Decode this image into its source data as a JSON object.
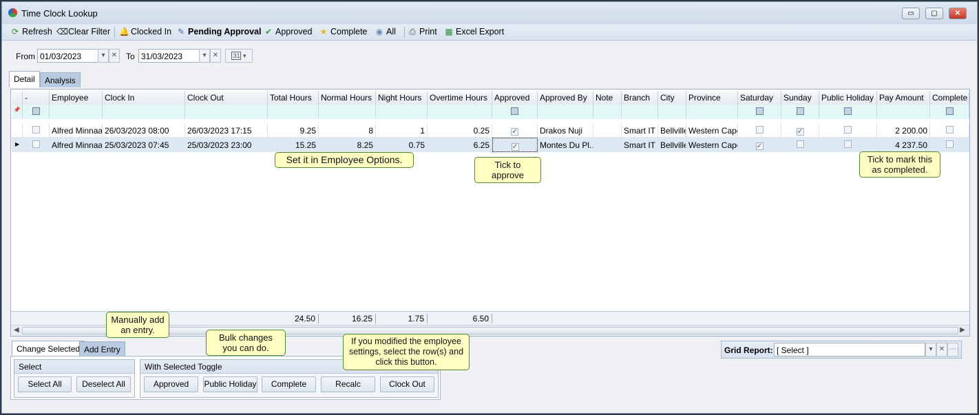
{
  "window": {
    "title": "Time Clock Lookup",
    "minimize": "▭",
    "maximize": "▢",
    "close": "✕"
  },
  "toolbar": [
    {
      "label": "Refresh",
      "icon": "refresh-icon",
      "glyph": "⟳",
      "color": "#3a8a3a"
    },
    {
      "label": "Clear Filter",
      "icon": "clear-filter-icon",
      "glyph": "⌫",
      "color": "#222"
    },
    {
      "label": "Clocked In",
      "icon": "bell-icon",
      "glyph": "🔔",
      "color": "#c9a227"
    },
    {
      "label": "Pending Approval",
      "icon": "pending-document-icon",
      "glyph": "✎",
      "color": "#3d6fb0",
      "bold": true
    },
    {
      "label": "Approved",
      "icon": "checkmark-icon",
      "glyph": "✔",
      "color": "#3a9a3a"
    },
    {
      "label": "Complete",
      "icon": "star-icon",
      "glyph": "★",
      "color": "#e9b520"
    },
    {
      "label": "All",
      "icon": "globe-icon",
      "glyph": "◉",
      "color": "#6f8eb0"
    },
    {
      "label": "Print",
      "icon": "print-preview-icon",
      "glyph": "⎙",
      "color": "#555"
    },
    {
      "label": "Excel Export",
      "icon": "excel-icon",
      "glyph": "▦",
      "color": "#2e8b3e"
    }
  ],
  "filter": {
    "from_label": "From",
    "from_value": "01/03/2023",
    "to_label": "To",
    "to_value": "31/03/2023",
    "calendar": "31"
  },
  "tabs": [
    "Detail",
    "Analysis"
  ],
  "grid": {
    "columns": [
      "-",
      "Employee",
      "Clock In",
      "Clock Out",
      "Total Hours",
      "Normal Hours",
      "Night Hours",
      "Overtime Hours",
      "Approved",
      "Approved By",
      "Note",
      "Branch",
      "City",
      "Province",
      "Saturday",
      "Sunday",
      "Public Holiday",
      "Pay Amount",
      "Complete"
    ],
    "rows": [
      {
        "selected": false,
        "employee": "Alfred Minnaar",
        "clock_in": "26/03/2023 08:00",
        "clock_out": "26/03/2023 17:15",
        "total": "9.25",
        "normal": "8",
        "night": "1",
        "overtime": "0.25",
        "approved": true,
        "approved_by": "Drakos Nuji",
        "note": "",
        "branch": "Smart IT",
        "city": "Bellville",
        "province": "Western Cape",
        "saturday": false,
        "sunday": true,
        "public_holiday": false,
        "pay": "2 200.00",
        "complete": false
      },
      {
        "selected": false,
        "employee": "Alfred Minnaar",
        "clock_in": "25/03/2023 07:45",
        "clock_out": "25/03/2023 23:00",
        "total": "15.25",
        "normal": "8.25",
        "night": "0.75",
        "overtime": "6.25",
        "approved": true,
        "approved_by": "Montes Du Pl...",
        "note": "",
        "branch": "Smart IT",
        "city": "Bellville",
        "province": "Western Cape",
        "saturday": true,
        "sunday": false,
        "public_holiday": false,
        "pay": "4 237.50",
        "complete": false,
        "current": true
      }
    ],
    "totals": {
      "total": "24.50",
      "normal": "16.25",
      "night": "1.75",
      "overtime": "6.50"
    }
  },
  "tips": {
    "employee_options": "Set it in Employee Options.",
    "approve": "Tick to approve",
    "complete": "Tick to mark this as completed.",
    "add_entry": "Manually add an entry.",
    "bulk": "Bulk changes you can do.",
    "recalc": "If you modified the employee settings, select the row(s) and click this button."
  },
  "bottom": {
    "tabs": [
      "Change Selected",
      "Add Entry"
    ],
    "select_group": "Select",
    "select_all": "Select All",
    "deselect_all": "Deselect All",
    "toggle_group": "With Selected Toggle",
    "toggle_buttons": [
      "Approved",
      "Public Holiday",
      "Complete",
      "Recalc",
      "Clock Out"
    ]
  },
  "grid_report": {
    "label": "Grid Report:",
    "value": "[ Select ]"
  }
}
